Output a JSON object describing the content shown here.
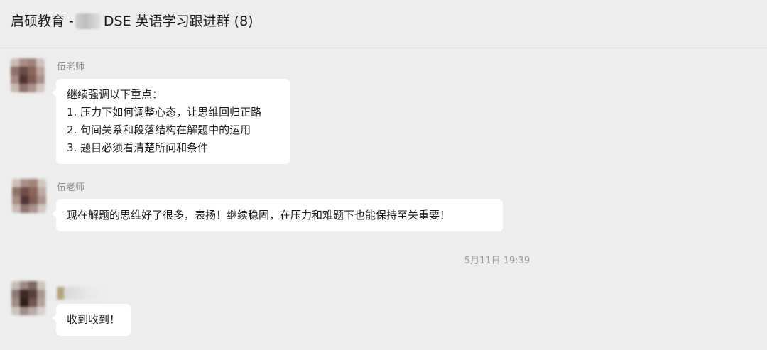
{
  "header": {
    "title_prefix": "启硕教育 -",
    "title_suffix": "DSE 英语学习跟进群 (8)"
  },
  "messages": [
    {
      "sender": "伍老师",
      "lines": [
        "继续强调以下重点：",
        "1. 压力下如何调整心态，让思维回归正路",
        "2. 句间关系和段落结构在解题中的运用",
        "3. 题目必须看清楚所问和条件"
      ]
    },
    {
      "sender": "伍老师",
      "lines": [
        "现在解题的思维好了很多，表扬！继续稳固，在压力和难题下也能保持至关重要！"
      ]
    },
    {
      "sender": "",
      "lines": [
        "收到收到！"
      ]
    }
  ],
  "timestamp": "5月11日 19:39",
  "colors": {
    "background": "#ededed",
    "bubble": "#ffffff",
    "sender_text": "#8b8b8b"
  }
}
